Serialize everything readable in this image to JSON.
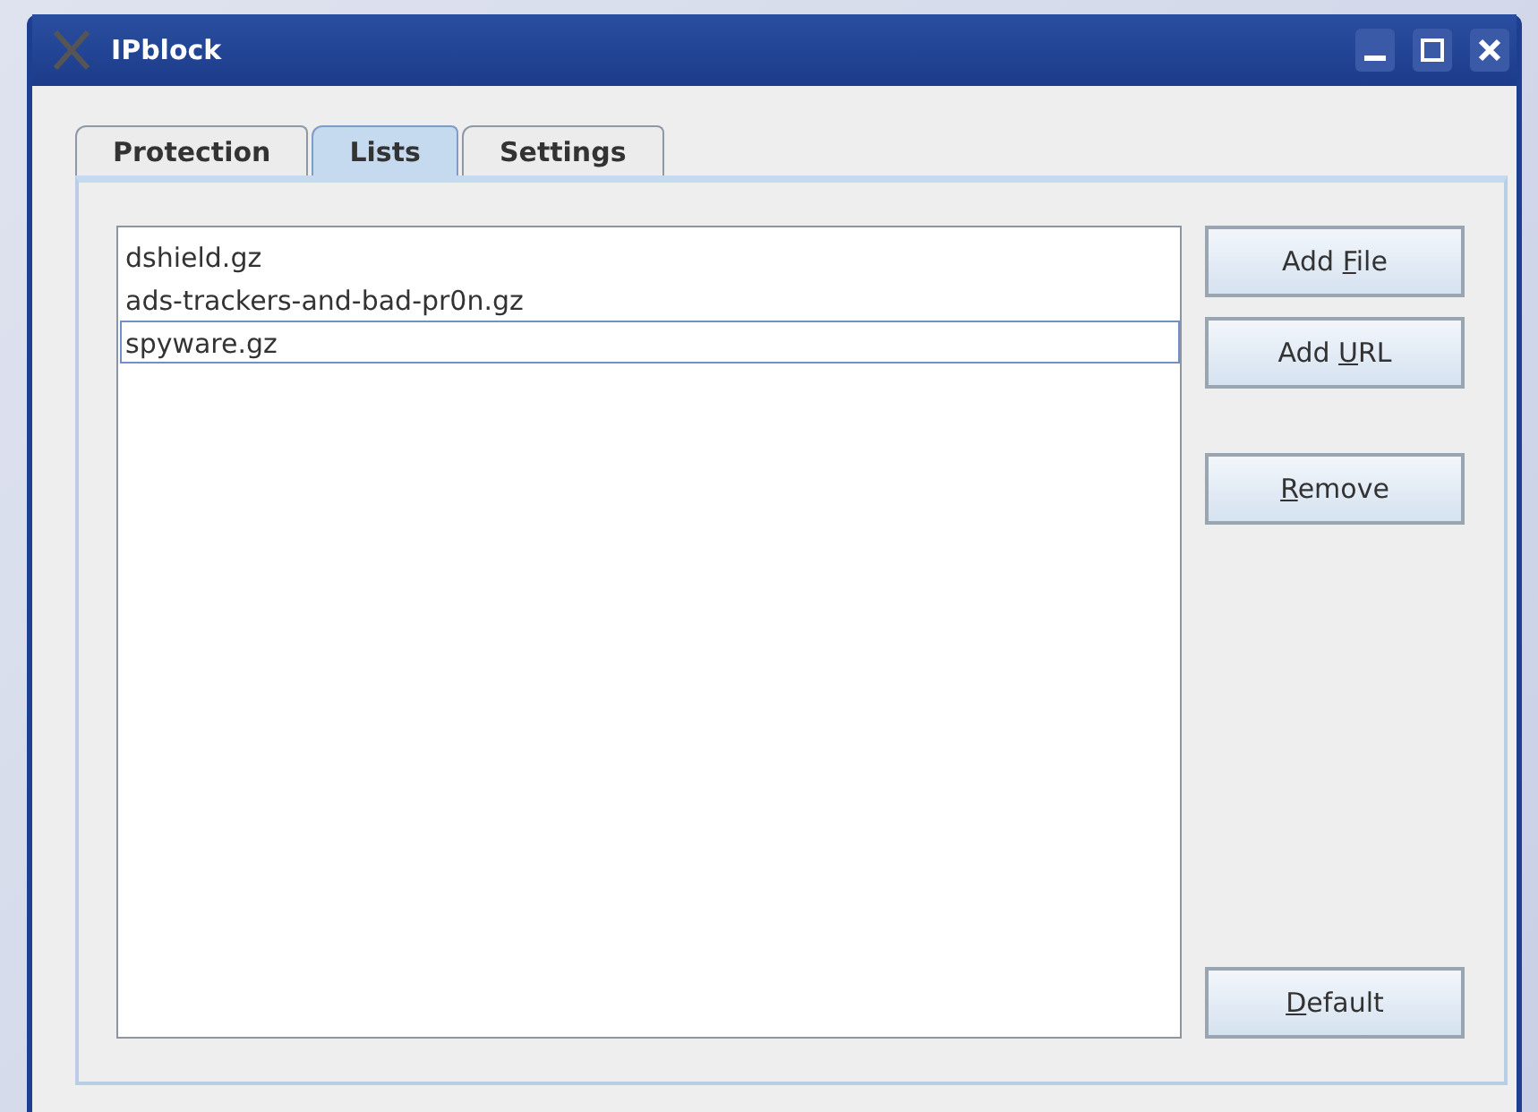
{
  "window": {
    "title": "IPblock"
  },
  "tabs": [
    {
      "label": "Protection",
      "selected": false
    },
    {
      "label": "Lists",
      "selected": true
    },
    {
      "label": "Settings",
      "selected": false
    }
  ],
  "lists": [
    {
      "name": "dshield.gz",
      "selected": false
    },
    {
      "name": "ads-trackers-and-bad-pr0n.gz",
      "selected": false
    },
    {
      "name": "spyware.gz",
      "selected": true
    }
  ],
  "buttons": [
    {
      "pre": "Add ",
      "key": "F",
      "post": "ile"
    },
    {
      "pre": "Add ",
      "key": "U",
      "post": "RL"
    },
    {
      "key": "R",
      "post": "emove"
    },
    {
      "key": "D",
      "post": "efault"
    }
  ]
}
